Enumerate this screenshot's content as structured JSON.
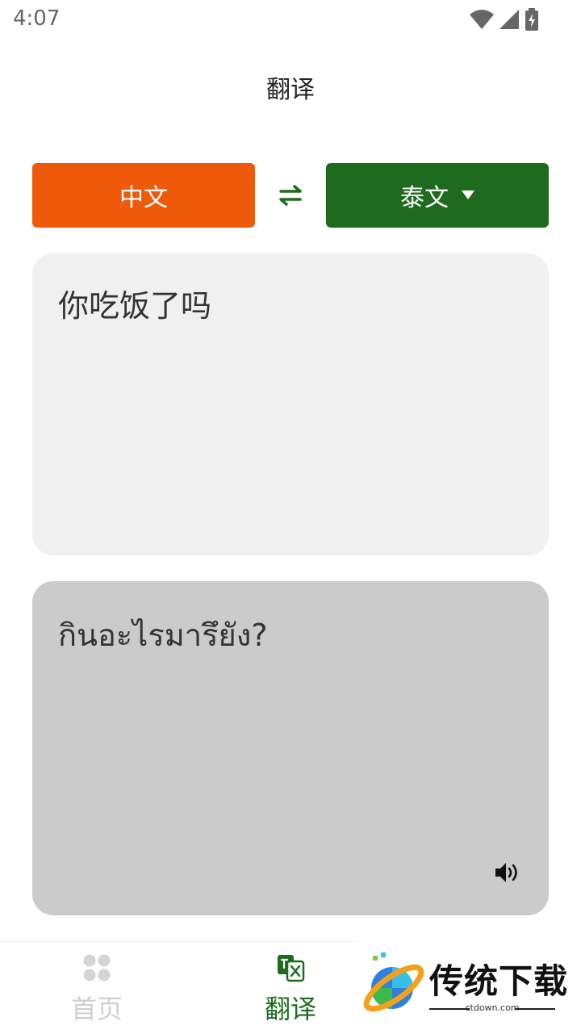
{
  "status_bar": {
    "time": "4:07"
  },
  "header": {
    "title": "翻译"
  },
  "languages": {
    "source": "中文",
    "target": "泰文"
  },
  "input": {
    "text": "你吃饭了吗"
  },
  "output": {
    "text": "กินอะไรมารึยัง?"
  },
  "bottom_nav": {
    "items": [
      {
        "label": "首页"
      },
      {
        "label": "翻译"
      }
    ]
  },
  "watermark": {
    "title": "传统下载",
    "site": "ctdown.com"
  },
  "colors": {
    "source_button": "#EE5A0A",
    "target_button": "#1E6B1F",
    "input_bg": "#F0F0F0",
    "output_bg": "#CBCBCB",
    "nav_active": "#1E6B1F",
    "nav_inactive": "#CFCFCF"
  }
}
